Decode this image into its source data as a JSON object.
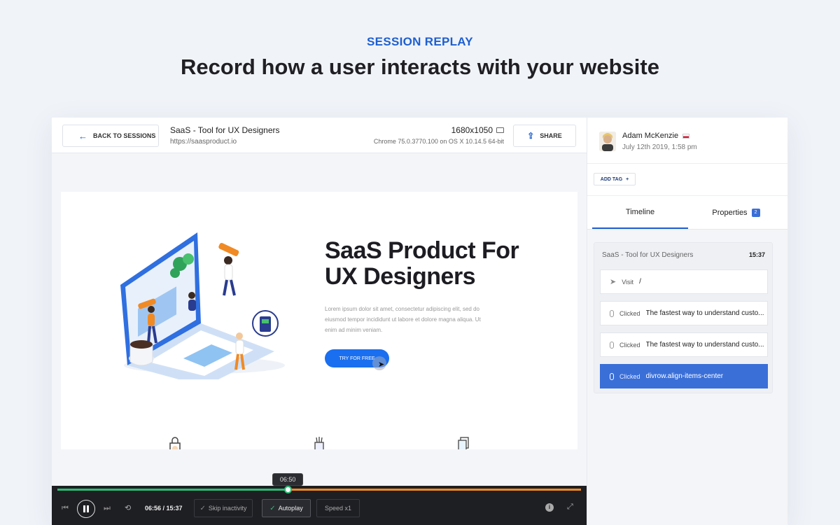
{
  "hero": {
    "eyebrow": "SESSION REPLAY",
    "headline": "Record how a user interacts with your website"
  },
  "toolbar": {
    "back_label": "BACK TO SESSIONS",
    "site_title": "SaaS - Tool for UX Designers",
    "site_url": "https://saasproduct.io",
    "resolution": "1680x1050",
    "browser": "Chrome 75.0.3770.100 on OS X 10.14.5 64-bit",
    "share_label": "SHARE"
  },
  "replay_site": {
    "title_line1": "SaaS Product For",
    "title_line2": "UX Designers",
    "text": "Lorem ipsum dolor sit amet, consectetur adipiscing elit, sed do eiusmod tempor incididunt ut labore et dolore magna aliqua. Ut enim ad minim veniam.",
    "cta": "TRY FOR FREE"
  },
  "player": {
    "progress": 0.44,
    "tooltip": "06:50",
    "time": "06:56 / 15:37",
    "skip_label": "Skip inactivity",
    "autoplay_label": "Autoplay",
    "speed_label": "Speed x1"
  },
  "panel": {
    "user_name": "Adam McKenzie",
    "user_date": "July 12th 2019, 1:58 pm",
    "add_tag": "ADD TAG",
    "tabs": [
      {
        "label": "Timeline"
      },
      {
        "label": "Properties",
        "badge": "2"
      }
    ],
    "session": {
      "title": "SaaS - Tool for UX Designers",
      "duration": "15:37",
      "events": [
        {
          "type": "Visit",
          "desc": "/"
        },
        {
          "type": "Clicked",
          "desc": "The fastest way to understand custo..."
        },
        {
          "type": "Clicked",
          "desc": "The fastest way to understand custo..."
        },
        {
          "type": "Clicked",
          "desc": "divrow.align-items-center"
        }
      ]
    }
  },
  "colors": {
    "accent": "#1e5fd0",
    "active_event": "#3a6fd8",
    "played": "#2dbd76",
    "orange": "#f08a24",
    "cta": "#1a6ff0"
  }
}
